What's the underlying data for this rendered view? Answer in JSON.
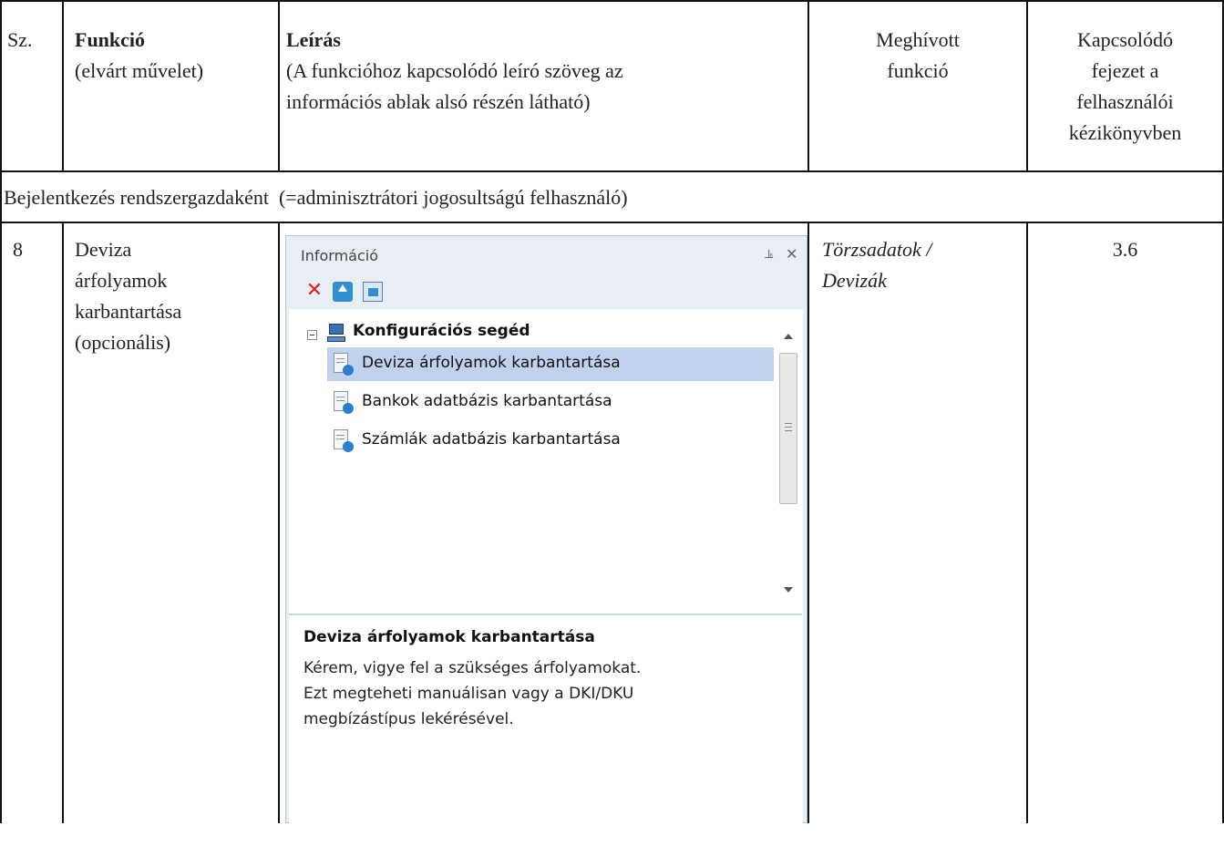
{
  "table": {
    "header": {
      "col_num": "Sz.",
      "col_func_title": "Funkció",
      "col_func_sub": "(elvárt művelet)",
      "col_desc_title": "Leírás",
      "col_desc_sub_1": "(A funkcióhoz kapcsolódó leíró szöveg az",
      "col_desc_sub_2": "információs ablak alsó részén látható)",
      "col_called_1": "Meghívott",
      "col_called_2": "funkció",
      "col_chapter_1": "Kapcsolódó",
      "col_chapter_2": "fejezet a",
      "col_chapter_3": "felhasználói",
      "col_chapter_4": "kézikönyvben"
    },
    "section_row": "Bejelentkezés rendszergazdaként  (=adminisztrátori jogosultságú felhasználó)",
    "row": {
      "num": "8",
      "func_1": "Deviza",
      "func_2": "árfolyamok",
      "func_3": "karbantartása",
      "func_4": "(opcionális)",
      "called_1": "Törzsadatok /",
      "called_2": "Devizák",
      "chapter": "3.6"
    }
  },
  "panel": {
    "title": "Információ",
    "pin_glyph": "ᵃ",
    "close_glyph": "✕",
    "toolbar": [
      "delete-icon",
      "up-icon",
      "new-window-icon"
    ],
    "tree": {
      "root_label": "Konfigurációs segéd",
      "items": [
        {
          "label": "Deviza árfolyamok karbantartása",
          "selected": true
        },
        {
          "label": "Bankok adatbázis karbantartása",
          "selected": false
        },
        {
          "label": "Számlák adatbázis karbantartása",
          "selected": false
        }
      ]
    },
    "description": {
      "title": "Deviza árfolyamok karbantartása",
      "body": "Kérem, vigye fel a szükséges árfolyamokat.\n Ezt megteheti manuálisan vagy a DKI/DKU\nmegbízástípus lekérésével."
    }
  },
  "colors": {
    "selection": "#bfd1ec",
    "panel_bg": "#e9edf4",
    "border": "#111111"
  }
}
